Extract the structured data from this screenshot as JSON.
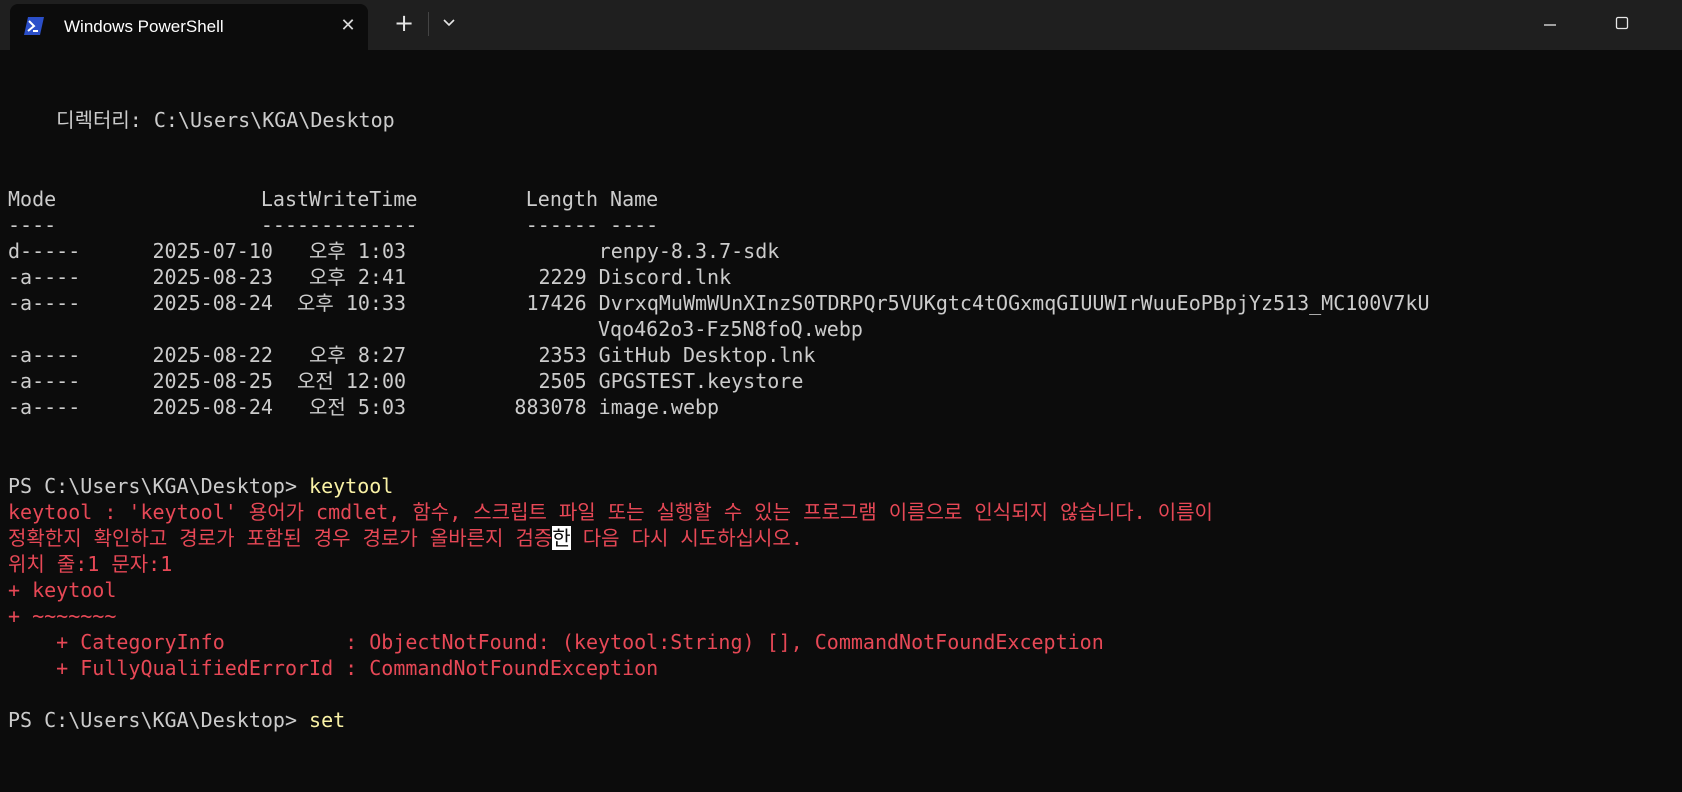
{
  "window": {
    "tab_title": "Windows PowerShell",
    "tab_icon": "powershell-icon",
    "close_tab_icon": "close-icon",
    "new_tab_icon": "plus-icon",
    "dropdown_icon": "chevron-down-icon",
    "minimize_icon": "minimize-icon",
    "maximize_icon": "maximize-icon",
    "close_tab_glyph": "✕",
    "new_tab_glyph": "+"
  },
  "colors": {
    "background": "#0c0c0c",
    "titlebar": "#1f1f1f",
    "text": "#cccccc",
    "error": "#e74856",
    "command": "#f9f1a5",
    "powershell_blue": "#2b4fc9"
  },
  "terminal": {
    "directory_line": "    디렉터리: C:\\Users\\KGA\\Desktop",
    "table_header": "Mode                 LastWriteTime         Length Name",
    "table_underline": "----                 -------------         ------ ----",
    "rows": [
      "d-----      2025-07-10   오후 1:03                renpy-8.3.7-sdk",
      "-a----      2025-08-23   오후 2:41           2229 Discord.lnk",
      "-a----      2025-08-24  오후 10:33          17426 DvrxqMuWmWUnXInzS0TDRPQr5VUKgtc4tOGxmqGIUUWIrWuuEoPBpjYz513_MC100V7kU",
      "                                                 Vqo462o3-Fz5N8foQ.webp",
      "-a----      2025-08-22   오후 8:27           2353 GitHub Desktop.lnk",
      "-a----      2025-08-25  오전 12:00           2505 GPGSTEST.keystore",
      "-a----      2025-08-24   오전 5:03         883078 image.webp"
    ],
    "prompt1": "PS C:\\Users\\KGA\\Desktop> ",
    "command1": "keytool",
    "error_line1": "keytool : 'keytool' 용어가 cmdlet, 함수, 스크립트 파일 또는 실행할 수 있는 프로그램 이름으로 인식되지 않습니다. 이름이",
    "error_line2_before": "정확한지 확인하고 경로가 포함된 경우 경로가 올바른지 검증",
    "error_line2_highlight": "한",
    "error_line2_after": " 다음 다시 시도하십시오.",
    "error_line3": "위치 줄:1 문자:1",
    "error_line4": "+ keytool",
    "error_line5": "+ ~~~~~~~",
    "error_line6": "    + CategoryInfo          : ObjectNotFound: (keytool:String) [], CommandNotFoundException",
    "error_line7": "    + FullyQualifiedErrorId : CommandNotFoundException",
    "prompt2": "PS C:\\Users\\KGA\\Desktop> ",
    "command2": "set"
  }
}
